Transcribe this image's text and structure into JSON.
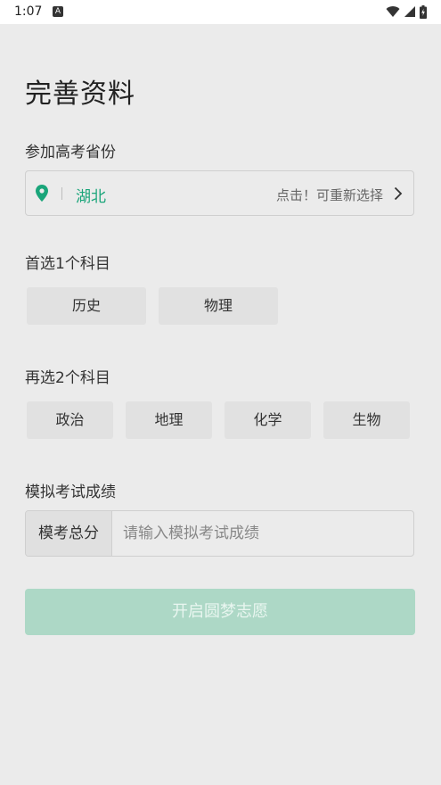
{
  "status_bar": {
    "time": "1:07",
    "notification_icon": "a-icon"
  },
  "page": {
    "title": "完善资料"
  },
  "province_section": {
    "label": "参加高考省份",
    "province": "湖北",
    "hint": "点击！可重新选择",
    "accent_color": "#1aa57a"
  },
  "first_subject": {
    "label": "首选1个科目",
    "options": [
      "历史",
      "物理"
    ]
  },
  "second_subject": {
    "label": "再选2个科目",
    "options": [
      "政治",
      "地理",
      "化学",
      "生物"
    ]
  },
  "score_section": {
    "label": "模拟考试成绩",
    "prefix": "模考总分",
    "placeholder": "请输入模拟考试成绩",
    "value": ""
  },
  "submit": {
    "label": "开启圆梦志愿",
    "color": "#add8c6"
  }
}
